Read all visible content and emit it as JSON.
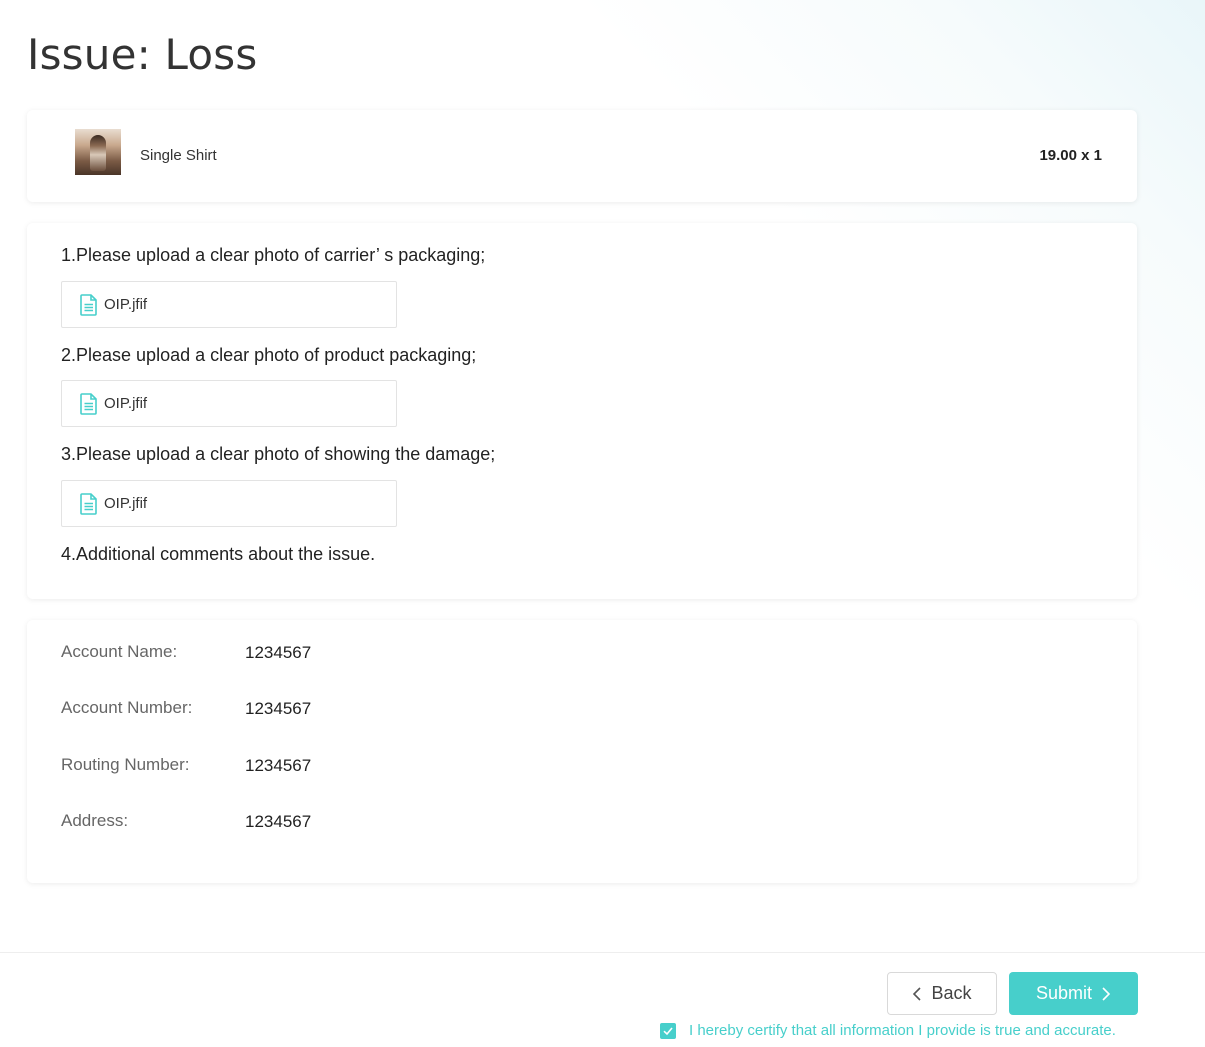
{
  "title": "Issue: Loss",
  "product": {
    "name": "Single Shirt",
    "price_qty": "19.00 x 1",
    "thumbnail_icon": "product-photo"
  },
  "uploads": [
    {
      "question": "1.Please upload a clear photo of carrier’ s packaging;",
      "file": "OIP.jfif"
    },
    {
      "question": "2.Please upload a clear photo of product packaging;",
      "file": "OIP.jfif"
    },
    {
      "question": "3.Please upload a clear photo of showing the damage;",
      "file": "OIP.jfif"
    }
  ],
  "comments_question": "4.Additional comments about the issue.",
  "account": [
    {
      "label": "Account Name:",
      "value": "1234567"
    },
    {
      "label": "Account Number:",
      "value": "1234567"
    },
    {
      "label": "Routing Number:",
      "value": "1234567"
    },
    {
      "label": "Address:",
      "value": "1234567"
    }
  ],
  "buttons": {
    "back": "Back",
    "submit": "Submit"
  },
  "certify": {
    "text": "I hereby certify that all information I provide is true and accurate.",
    "checked": true
  },
  "colors": {
    "accent": "#47cfcb",
    "text": "#333333",
    "label": "#666666"
  }
}
